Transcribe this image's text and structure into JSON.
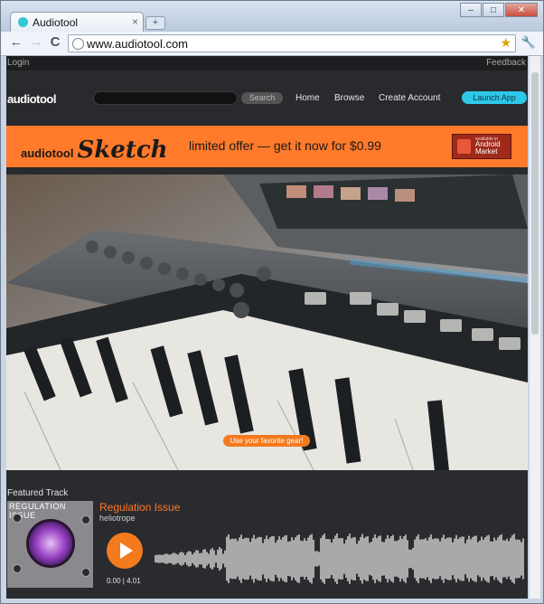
{
  "browser": {
    "tab_title": "Audiotool",
    "tab_close": "×",
    "new_tab": "+",
    "url": "www.audiotool.com",
    "controls": {
      "minimize": "–",
      "maximize": "□",
      "close": "✕"
    },
    "nav": {
      "back": "←",
      "forward": "→",
      "reload": "C"
    }
  },
  "site": {
    "topbar": {
      "login": "Login",
      "feedback": "Feedback"
    },
    "header": {
      "logo": "audiotool",
      "search_placeholder": "",
      "search_button": "Search",
      "nav": [
        "Home",
        "Browse",
        "Create Account"
      ],
      "launch_button": "Launch App"
    },
    "banner": {
      "brand_prefix": "audiotool",
      "brand_sketch": "Sketch",
      "offer": "limited offer — get it now for $0.99",
      "badge_small": "available in",
      "badge_line1": "Android",
      "badge_line2": "Market"
    },
    "hero": {
      "cta": "Use your favorite gear!"
    },
    "featured": {
      "label": "Featured Track",
      "art_title": "REGULATION ISSUE",
      "title": "Regulation Issue",
      "artist": "heliotrope",
      "time": "0.00 | 4.01"
    }
  },
  "colors": {
    "accent_orange": "#ff7a2a",
    "launch_cyan": "#2ec8e8",
    "page_bg": "#2a2b2e"
  },
  "icons": [
    "globe-icon",
    "star-icon",
    "wrench-icon",
    "play-icon",
    "android-bag-icon"
  ]
}
